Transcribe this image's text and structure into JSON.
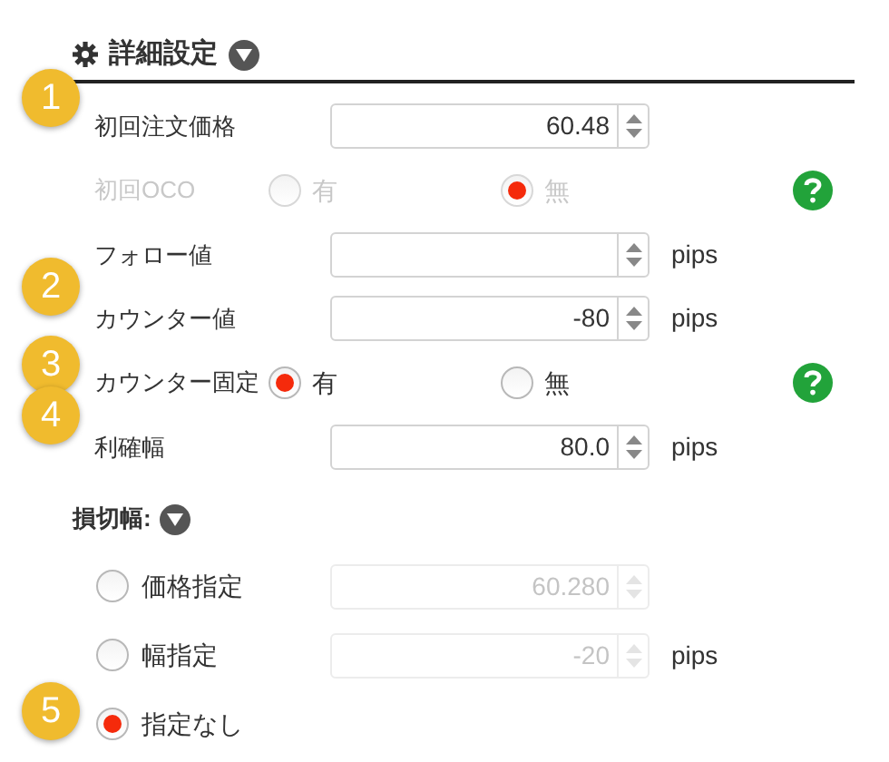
{
  "section": {
    "title": "詳細設定"
  },
  "rows": [
    {
      "kind": "number",
      "label": "初回注文価格",
      "value": "60.48",
      "badge": "1"
    },
    {
      "kind": "radio",
      "label": "初回OCO",
      "disabled": true,
      "help": true,
      "options": [
        {
          "label": "有",
          "selected": false
        },
        {
          "label": "無",
          "selected": true
        }
      ]
    },
    {
      "kind": "number",
      "label": "フォロー値",
      "value": "",
      "unit": "pips"
    },
    {
      "kind": "number",
      "label": "カウンター値",
      "value": "-80",
      "unit": "pips",
      "badge": "2"
    },
    {
      "kind": "radio",
      "label": "カウンター固定",
      "disabled": false,
      "help": true,
      "badge": "3",
      "options": [
        {
          "label": "有",
          "selected": true
        },
        {
          "label": "無",
          "selected": false
        }
      ]
    },
    {
      "kind": "number",
      "label": "利確幅",
      "value": "80.0",
      "unit": "pips",
      "badge": "4"
    }
  ],
  "stop_loss": {
    "title": "損切幅:",
    "options": [
      {
        "label": "価格指定",
        "selected": false,
        "value": "60.280",
        "disabled": true
      },
      {
        "label": "幅指定",
        "selected": false,
        "value": "-20",
        "unit": "pips",
        "disabled": true
      },
      {
        "label": "指定なし",
        "selected": true,
        "badge": "5"
      }
    ]
  }
}
